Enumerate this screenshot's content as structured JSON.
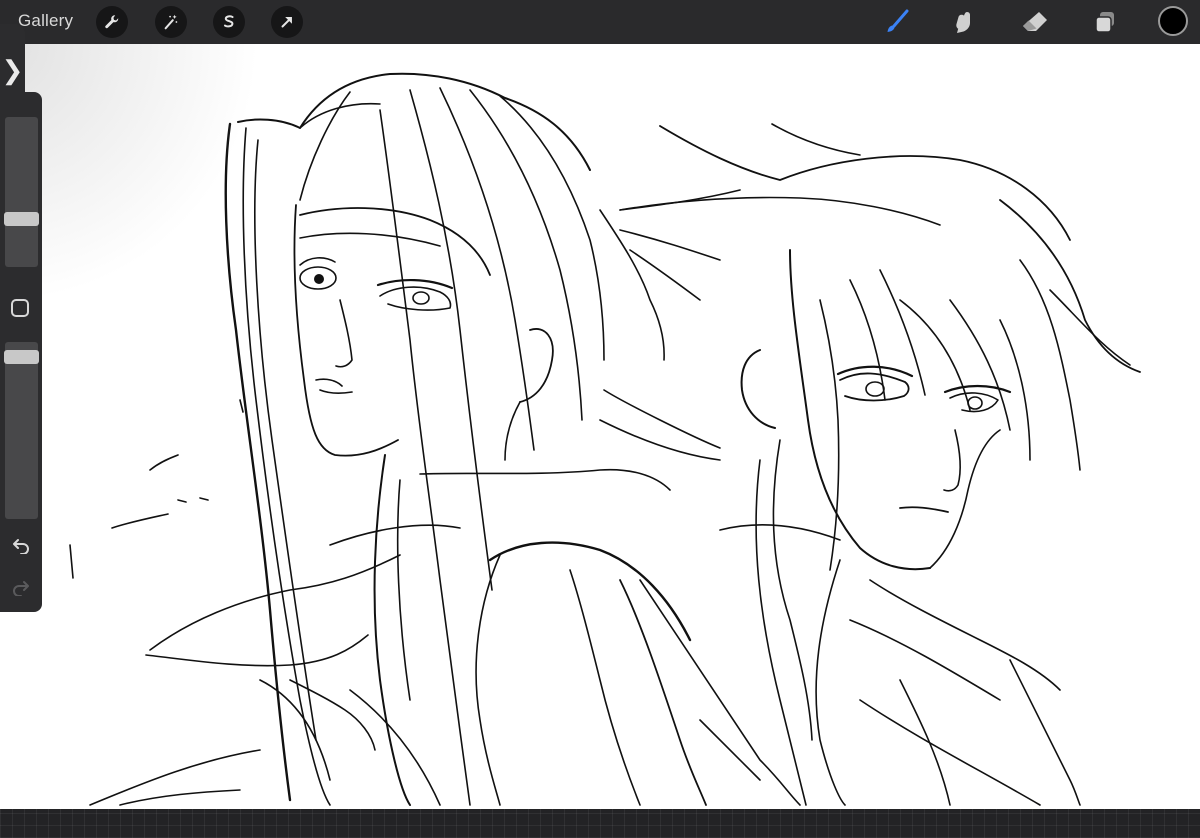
{
  "toolbar": {
    "gallery_label": "Gallery",
    "left_tools": [
      "wrench-icon",
      "magic-wand-icon",
      "selection-icon",
      "transform-arrow-icon"
    ],
    "right_tools": [
      "brush-icon",
      "smudge-icon",
      "eraser-icon",
      "layers-icon"
    ],
    "active_tool": "brush-icon",
    "accent_color": "#3b82f6",
    "current_color": "#000000"
  },
  "sidebar": {
    "toggle_glyph": "❯",
    "brush_size_level": 0.35,
    "opacity_level": 0.05
  },
  "colors": {
    "toolbar_bg": "#2a2a2c",
    "canvas_bg": "#ffffff",
    "stroke": "#111111"
  }
}
